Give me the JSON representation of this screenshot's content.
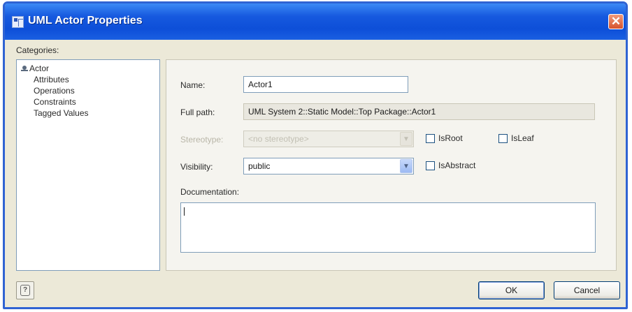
{
  "window": {
    "title": "UML Actor Properties",
    "close_glyph": "✕"
  },
  "categories": {
    "label": "Categories:",
    "root": "Actor",
    "items": [
      "Attributes",
      "Operations",
      "Constraints",
      "Tagged Values"
    ]
  },
  "form": {
    "name_label": "Name:",
    "name_value": "Actor1",
    "fullpath_label": "Full path:",
    "fullpath_value": "UML System 2::Static Model::Top Package::Actor1",
    "stereotype_label": "Stereotype:",
    "stereotype_value": "<no stereotype>",
    "visibility_label": "Visibility:",
    "visibility_value": "public",
    "isroot_label": "IsRoot",
    "isleaf_label": "IsLeaf",
    "isabstract_label": "IsAbstract",
    "documentation_label": "Documentation:",
    "documentation_value": ""
  },
  "buttons": {
    "help_glyph": "?",
    "ok": "OK",
    "cancel": "Cancel"
  },
  "icons": {
    "title": "dialog-icon",
    "actor": "actor-icon",
    "help": "help-icon",
    "dropdown": "chevron-down-icon",
    "close": "close-icon"
  },
  "colors": {
    "titlebar": "#1659df",
    "close_button": "#d6522d",
    "dialog_background": "#ece9d8",
    "field_border": "#7f9db9"
  }
}
